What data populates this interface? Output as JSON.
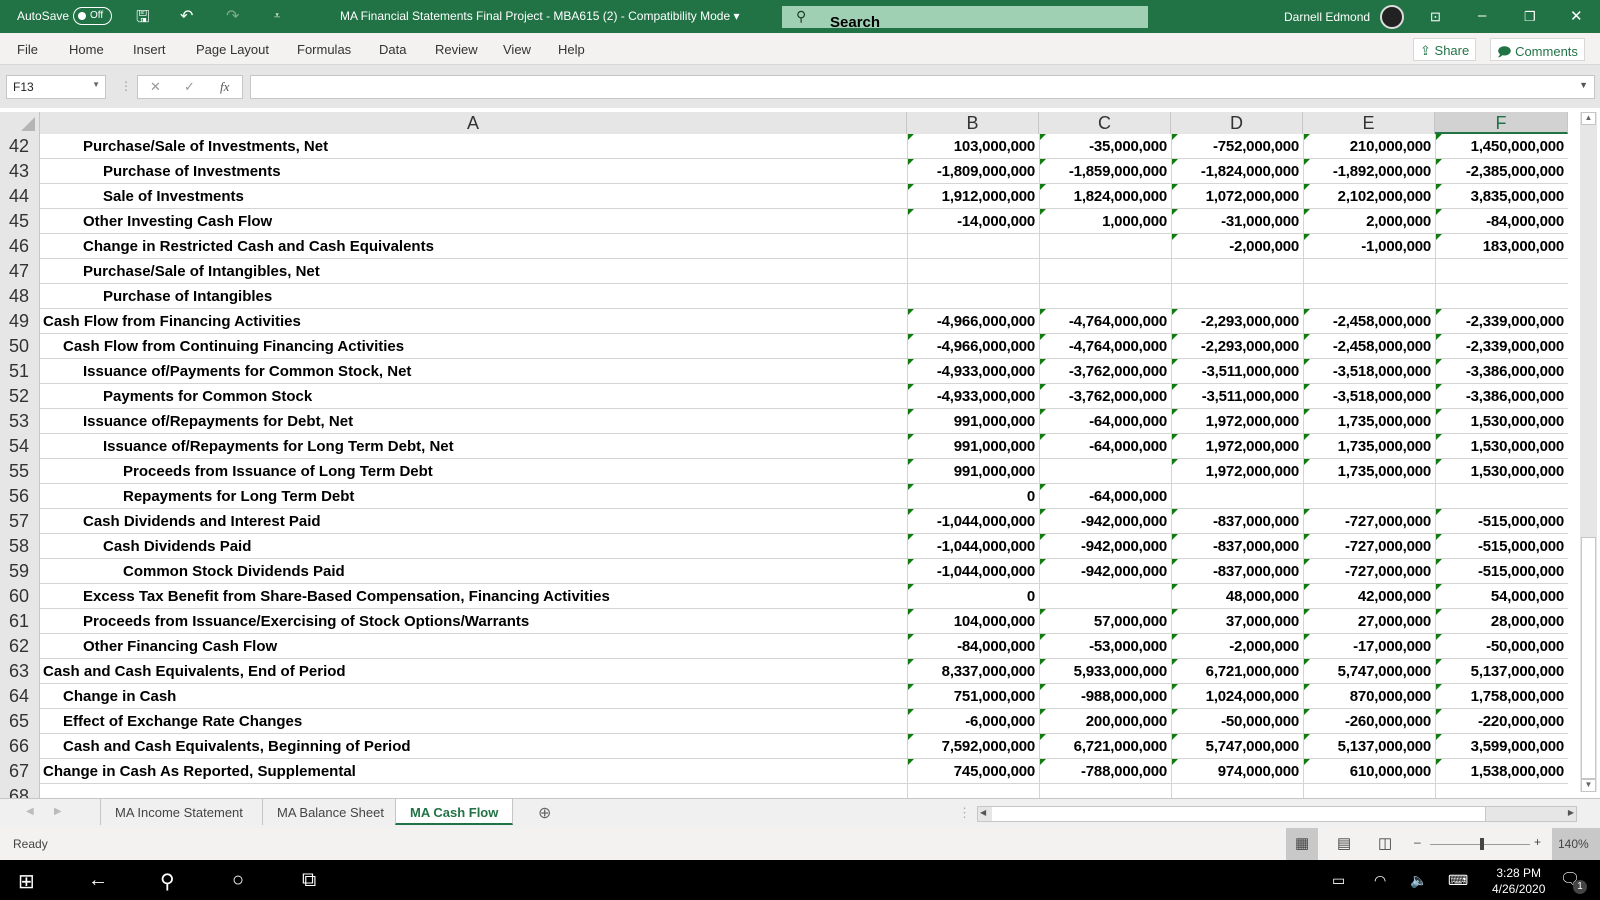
{
  "titlebar": {
    "autosave_label": "AutoSave",
    "autosave_state": "Off",
    "document_title": "MA Financial Statements Final Project - MBA615 (2)  -  Compatibility Mode",
    "search_placeholder": "Search",
    "user_name": "Darnell Edmond"
  },
  "menu": [
    "File",
    "Home",
    "Insert",
    "Page Layout",
    "Formulas",
    "Data",
    "Review",
    "View",
    "Help"
  ],
  "share_label": "Share",
  "comments_label": "Comments",
  "formula_bar": {
    "name_box": "F13",
    "formula": "",
    "fx": "fx"
  },
  "columns": [
    "A",
    "B",
    "C",
    "D",
    "E",
    "F"
  ],
  "selected_column": "F",
  "rows": [
    {
      "n": "42",
      "indent": 2,
      "label": "Purchase/Sale of Investments, Net",
      "v": [
        "103,000,000",
        "-35,000,000",
        "-752,000,000",
        "210,000,000",
        "1,450,000,000"
      ]
    },
    {
      "n": "43",
      "indent": 3,
      "label": "Purchase of Investments",
      "v": [
        "-1,809,000,000",
        "-1,859,000,000",
        "-1,824,000,000",
        "-1,892,000,000",
        "-2,385,000,000"
      ]
    },
    {
      "n": "44",
      "indent": 3,
      "label": "Sale of Investments",
      "v": [
        "1,912,000,000",
        "1,824,000,000",
        "1,072,000,000",
        "2,102,000,000",
        "3,835,000,000"
      ]
    },
    {
      "n": "45",
      "indent": 2,
      "label": "Other Investing Cash Flow",
      "v": [
        "-14,000,000",
        "1,000,000",
        "-31,000,000",
        "2,000,000",
        "-84,000,000"
      ]
    },
    {
      "n": "46",
      "indent": 2,
      "label": "Change in Restricted Cash and Cash Equivalents",
      "v": [
        "",
        "",
        "-2,000,000",
        "-1,000,000",
        "183,000,000"
      ]
    },
    {
      "n": "47",
      "indent": 2,
      "label": "Purchase/Sale of Intangibles, Net",
      "v": [
        "",
        "",
        "",
        "",
        ""
      ]
    },
    {
      "n": "48",
      "indent": 3,
      "label": "Purchase of Intangibles",
      "v": [
        "",
        "",
        "",
        "",
        ""
      ]
    },
    {
      "n": "49",
      "indent": 0,
      "label": "Cash Flow from Financing Activities",
      "v": [
        "-4,966,000,000",
        "-4,764,000,000",
        "-2,293,000,000",
        "-2,458,000,000",
        "-2,339,000,000"
      ]
    },
    {
      "n": "50",
      "indent": 1,
      "label": "Cash Flow from Continuing Financing Activities",
      "v": [
        "-4,966,000,000",
        "-4,764,000,000",
        "-2,293,000,000",
        "-2,458,000,000",
        "-2,339,000,000"
      ]
    },
    {
      "n": "51",
      "indent": 2,
      "label": "Issuance of/Payments for Common Stock, Net",
      "v": [
        "-4,933,000,000",
        "-3,762,000,000",
        "-3,511,000,000",
        "-3,518,000,000",
        "-3,386,000,000"
      ]
    },
    {
      "n": "52",
      "indent": 3,
      "label": "Payments for Common Stock",
      "v": [
        "-4,933,000,000",
        "-3,762,000,000",
        "-3,511,000,000",
        "-3,518,000,000",
        "-3,386,000,000"
      ]
    },
    {
      "n": "53",
      "indent": 2,
      "label": "Issuance of/Repayments for Debt, Net",
      "v": [
        "991,000,000",
        "-64,000,000",
        "1,972,000,000",
        "1,735,000,000",
        "1,530,000,000"
      ]
    },
    {
      "n": "54",
      "indent": 3,
      "label": "Issuance of/Repayments for Long Term Debt, Net",
      "v": [
        "991,000,000",
        "-64,000,000",
        "1,972,000,000",
        "1,735,000,000",
        "1,530,000,000"
      ]
    },
    {
      "n": "55",
      "indent": 4,
      "label": "Proceeds from Issuance of Long Term Debt",
      "v": [
        "991,000,000",
        "",
        "1,972,000,000",
        "1,735,000,000",
        "1,530,000,000"
      ]
    },
    {
      "n": "56",
      "indent": 4,
      "label": "Repayments for Long Term Debt",
      "v": [
        "0",
        "-64,000,000",
        "",
        "",
        ""
      ]
    },
    {
      "n": "57",
      "indent": 2,
      "label": "Cash Dividends and Interest Paid",
      "v": [
        "-1,044,000,000",
        "-942,000,000",
        "-837,000,000",
        "-727,000,000",
        "-515,000,000"
      ]
    },
    {
      "n": "58",
      "indent": 3,
      "label": "Cash Dividends Paid",
      "v": [
        "-1,044,000,000",
        "-942,000,000",
        "-837,000,000",
        "-727,000,000",
        "-515,000,000"
      ]
    },
    {
      "n": "59",
      "indent": 4,
      "label": "Common Stock Dividends Paid",
      "v": [
        "-1,044,000,000",
        "-942,000,000",
        "-837,000,000",
        "-727,000,000",
        "-515,000,000"
      ]
    },
    {
      "n": "60",
      "indent": 2,
      "label": "Excess Tax Benefit from Share-Based Compensation, Financing Activities",
      "v": [
        "0",
        "",
        "48,000,000",
        "42,000,000",
        "54,000,000"
      ]
    },
    {
      "n": "61",
      "indent": 2,
      "label": "Proceeds from Issuance/Exercising of Stock Options/Warrants",
      "v": [
        "104,000,000",
        "57,000,000",
        "37,000,000",
        "27,000,000",
        "28,000,000"
      ]
    },
    {
      "n": "62",
      "indent": 2,
      "label": "Other Financing Cash Flow",
      "v": [
        "-84,000,000",
        "-53,000,000",
        "-2,000,000",
        "-17,000,000",
        "-50,000,000"
      ]
    },
    {
      "n": "63",
      "indent": 0,
      "label": "Cash and Cash Equivalents, End of Period",
      "v": [
        "8,337,000,000",
        "5,933,000,000",
        "6,721,000,000",
        "5,747,000,000",
        "5,137,000,000"
      ]
    },
    {
      "n": "64",
      "indent": 1,
      "label": "Change in Cash",
      "v": [
        "751,000,000",
        "-988,000,000",
        "1,024,000,000",
        "870,000,000",
        "1,758,000,000"
      ]
    },
    {
      "n": "65",
      "indent": 1,
      "label": "Effect of Exchange Rate Changes",
      "v": [
        "-6,000,000",
        "200,000,000",
        "-50,000,000",
        "-260,000,000",
        "-220,000,000"
      ]
    },
    {
      "n": "66",
      "indent": 1,
      "label": "Cash and Cash Equivalents, Beginning of Period",
      "v": [
        "7,592,000,000",
        "6,721,000,000",
        "5,747,000,000",
        "5,137,000,000",
        "3,599,000,000"
      ]
    },
    {
      "n": "67",
      "indent": 0,
      "label": "Change in Cash As Reported, Supplemental",
      "v": [
        "745,000,000",
        "-788,000,000",
        "974,000,000",
        "610,000,000",
        "1,538,000,000"
      ]
    },
    {
      "n": "68",
      "indent": 0,
      "label": "",
      "v": [
        "",
        "",
        "",
        "",
        ""
      ]
    }
  ],
  "sheet_tabs": [
    "MA Income Statement",
    "MA Balance Sheet",
    "MA Cash Flow"
  ],
  "active_sheet": "MA Cash Flow",
  "status": "Ready",
  "zoom_level": "140%",
  "taskbar": {
    "time": "3:28 PM",
    "date": "4/26/2020",
    "notifications": "1"
  },
  "colors": {
    "accent": "#217346",
    "error_triangle": "#107c10"
  }
}
